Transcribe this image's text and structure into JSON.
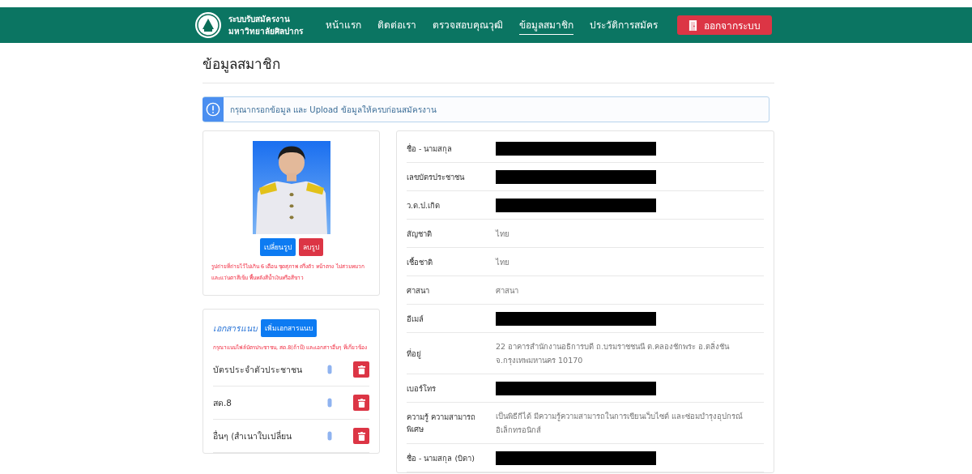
{
  "navbar": {
    "brand_line_1": "ระบบรับสมัครงาน",
    "brand_line_2": "มหาวิทยาลัยศิลปากร",
    "links": [
      {
        "label": "หน้าแรก",
        "selected": false
      },
      {
        "label": "ติดต่อเรา",
        "selected": false
      },
      {
        "label": "ตรวจสอบคุณวุฒิ",
        "selected": false
      },
      {
        "label": "ข้อมูลสมาชิก",
        "selected": true
      },
      {
        "label": "ประวัติการสมัคร",
        "selected": false
      }
    ],
    "logout_button": "ออกจากระบบ"
  },
  "page_title": "ข้อมูลสมาชิก",
  "alert": "กรุณากรอกข้อมูล และ Upload ข้อมูลให้ครบก่อนสมัครงาน",
  "photo_card": {
    "change_button": "เปลี่ยนรูป",
    "delete_button": "ลบรูป",
    "note": "รูปถ่ายที่ถ่ายไว้ไม่เกิน 6 เดือน ชุดสุภาพ ครึ่งตัว หน้าตรง ไม่สวมหมวกและแว่นตาสีเข้ม พื้นหลังสีน้ำเงินหรือสีขาว"
  },
  "attachments": {
    "title": "เอกสารแนบ",
    "add_button": "เพิ่มเอกสารแนบ",
    "note": "กรุณาแนบไฟล์บัตรประชาชน, สด.8(ถ้ามี) และเอกสารอื่นๆ ที่เกี่ยวข้อง",
    "items": [
      {
        "name": "บัตรประจำตัวประชาชน"
      },
      {
        "name": "สด.8"
      },
      {
        "name": "อื่นๆ (สำเนาใบเปลี่ยน"
      }
    ]
  },
  "profile": [
    {
      "label": "ชื่อ - นามสกุล",
      "kind": "redacted"
    },
    {
      "label": "เลขบัตรประชาชน",
      "kind": "redacted"
    },
    {
      "label": "ว.ด.ป.เกิด",
      "kind": "redacted"
    },
    {
      "label": "สัญชาติ",
      "kind": "text",
      "value": "ไทย"
    },
    {
      "label": "เชื้อชาติ",
      "kind": "text",
      "value": "ไทย"
    },
    {
      "label": "ศาสนา",
      "kind": "text",
      "value": "ศาสนา"
    },
    {
      "label": "อีเมล์",
      "kind": "redacted"
    },
    {
      "label": "ที่อยู่",
      "kind": "text",
      "value": "22 อาคารสำนักงานอธิการบดี ถ.บรมราชชนนี ต.คลองชักพระ อ.ตลิ่งชัน จ.กรุงเทพมหานคร 10170"
    },
    {
      "label": "เบอร์โทร",
      "kind": "redacted"
    },
    {
      "label": "ความรู้ ความสามารถพิเศษ",
      "kind": "text",
      "value": "เป็นพิธีกีได้ มีความรู้ความสามารถในการเขียนเว็บไซต์ และซ่อมบำรุงอุปกรณ์อิเล็กทรอนิกส์"
    },
    {
      "label": "ชื่อ - นามสกุล (บิดา)",
      "kind": "redacted"
    }
  ]
}
